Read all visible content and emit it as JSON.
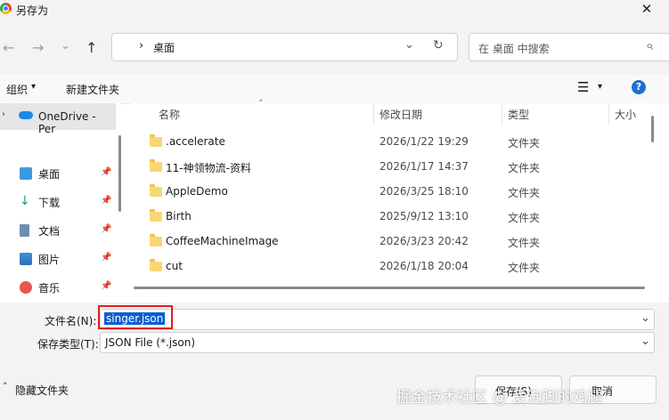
{
  "window": {
    "title": "另存为",
    "close_glyph": "✕"
  },
  "nav": {
    "back_glyph": "←",
    "forward_glyph": "→",
    "recent_glyph": "⌄",
    "up_glyph": "↑",
    "address": {
      "chevron": "›",
      "location": "桌面",
      "dropdown_glyph": "⌄",
      "refresh_glyph": "↻"
    },
    "search": {
      "placeholder": "在 桌面 中搜索",
      "icon_glyph": "⌕"
    }
  },
  "toolbar": {
    "organize_label": "组织",
    "organize_caret": "▾",
    "new_folder_label": "新建文件夹",
    "view_glyph": "☰",
    "view_caret": "▾",
    "help_glyph": "?"
  },
  "sidebar": {
    "onedrive_label": "OneDrive - Per",
    "items": [
      {
        "label": "桌面",
        "icon": "desktop-icon",
        "pin": "📌"
      },
      {
        "label": "下载",
        "icon": "download-icon",
        "pin": "📌"
      },
      {
        "label": "文档",
        "icon": "document-icon",
        "pin": "📌"
      },
      {
        "label": "图片",
        "icon": "pictures-icon",
        "pin": "📌"
      },
      {
        "label": "音乐",
        "icon": "music-icon",
        "pin": "📌"
      }
    ]
  },
  "file_list": {
    "columns": {
      "name": "名称",
      "date": "修改日期",
      "type": "类型",
      "size": "大小",
      "sort_glyph": "˄"
    },
    "rows": [
      {
        "name": ".accelerate",
        "date": "2026/1/22 19:29",
        "type": "文件夹"
      },
      {
        "name": "11-神领物流-资料",
        "date": "2026/1/17 14:37",
        "type": "文件夹"
      },
      {
        "name": "AppleDemo",
        "date": "2026/3/25 18:10",
        "type": "文件夹"
      },
      {
        "name": "Birth",
        "date": "2025/9/12 13:10",
        "type": "文件夹"
      },
      {
        "name": "CoffeeMachineImage",
        "date": "2026/3/23 20:42",
        "type": "文件夹"
      },
      {
        "name": "cut",
        "date": "2026/1/18 20:04",
        "type": "文件夹"
      }
    ]
  },
  "save_form": {
    "filename_label": "文件名(N):",
    "filename_value": "singer.json",
    "savetype_label": "保存类型(T):",
    "savetype_value": "JSON File (*.json)",
    "dropdown_glyph": "⌄",
    "highlight_color": "#e0201e",
    "selection_color": "#0a5fd0"
  },
  "footer": {
    "hide_folders_label": "隐藏文件夹",
    "hide_folders_glyph": "˄",
    "save_button": "保存(S)",
    "cancel_button": "取消",
    "watermark": "掘金技术社区 @ 爱泡脚的鸡腿"
  }
}
